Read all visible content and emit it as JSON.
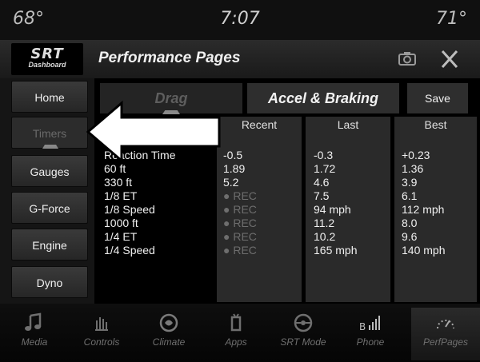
{
  "status": {
    "temp_left": "68°",
    "clock": "7:07",
    "temp_right": "71°"
  },
  "header": {
    "logo_top": "SRT",
    "logo_bottom": "Dashboard",
    "title": "Performance Pages"
  },
  "sidebar": {
    "items": [
      "Home",
      "Timers",
      "Gauges",
      "G-Force",
      "Engine",
      "Dyno"
    ]
  },
  "tabs": {
    "drag": "Drag",
    "accel": "Accel & Braking",
    "save": "Save"
  },
  "table": {
    "headers": [
      "Recent",
      "Last",
      "Best"
    ],
    "labels": [
      "Reaction Time",
      "60 ft",
      "330 ft",
      "1/8 ET",
      "1/8 Speed",
      "1000 ft",
      "1/4 ET",
      "1/4 Speed"
    ],
    "recent": [
      "-0.5",
      "1.89",
      "5.2",
      "REC",
      "REC",
      "REC",
      "REC",
      "REC"
    ],
    "last": [
      "-0.3",
      "1.72",
      "4.6",
      "7.5",
      "94 mph",
      "11.2",
      "10.2",
      "165 mph"
    ],
    "best": [
      "+0.23",
      "1.36",
      "3.9",
      "6.1",
      "112 mph",
      "8.0",
      "9.6",
      "140 mph"
    ]
  },
  "nav": {
    "items": [
      "Media",
      "Controls",
      "Climate",
      "Apps",
      "SRT Mode",
      "Phone",
      "PerfPages"
    ]
  },
  "colors": {
    "background": "#000000",
    "panel": "#2a2a2a",
    "text": "#f0f0f0",
    "dim_text": "#6e6e6e"
  }
}
